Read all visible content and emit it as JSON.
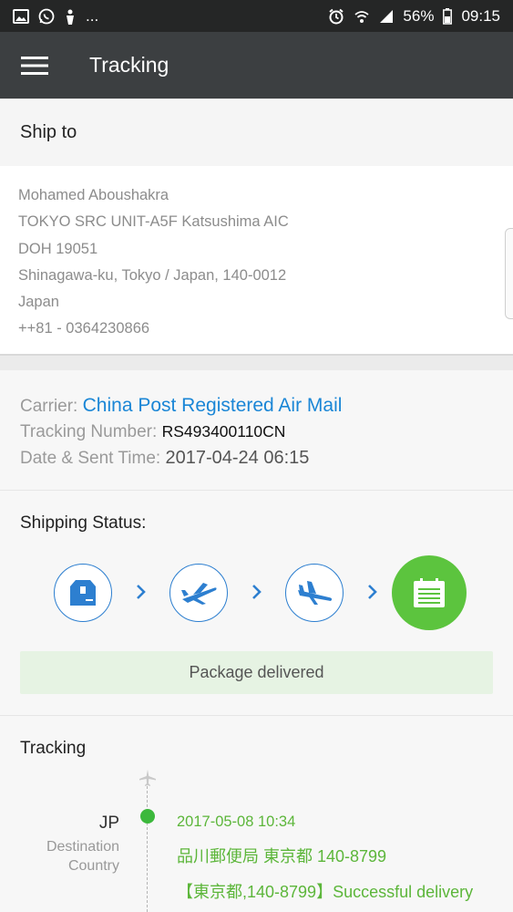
{
  "status_bar": {
    "icons_left": [
      "image-icon",
      "whatsapp-icon",
      "notification-icon",
      "more-icon"
    ],
    "more_text": "...",
    "battery": "56%",
    "time": "09:15"
  },
  "toolbar": {
    "title": "Tracking"
  },
  "ship_to": {
    "heading": "Ship to",
    "lines": [
      "Mohamed Aboushakra",
      "TOKYO SRC UNIT-A5F Katsushima AIC",
      "DOH 19051",
      "Shinagawa-ku, Tokyo / Japan, 140-0012",
      "Japan",
      "++81 - 0364230866"
    ]
  },
  "shipment": {
    "carrier_label": "Carrier: ",
    "carrier_value": "China Post Registered Air Mail",
    "tracking_label": "Tracking Number: ",
    "tracking_value": "RS493400110CN",
    "date_label": "Date & Sent Time: ",
    "date_value": "2017-04-24 06:15"
  },
  "shipping_status": {
    "heading": "Shipping Status:",
    "steps": [
      "package-icon",
      "plane-takeoff-icon",
      "plane-landing-icon",
      "delivered-icon"
    ],
    "current_step": 4,
    "banner": "Package delivered"
  },
  "tracking": {
    "heading": "Tracking",
    "country_code": "JP",
    "country_label_1": "Destination",
    "country_label_2": "Country",
    "events": [
      {
        "datetime": "2017-05-08 10:34",
        "location": "品川郵便局 東京都 140-8799",
        "description": "【東京都,140-8799】Successful delivery"
      }
    ]
  },
  "colors": {
    "toolbar": "#3c3f41",
    "status_bar": "#252626",
    "link_blue": "#1a86d6",
    "step_blue": "#2d7fd0",
    "success_green": "#5cc43e",
    "event_green": "#5cb63a",
    "banner_bg": "#e6f3e3"
  }
}
